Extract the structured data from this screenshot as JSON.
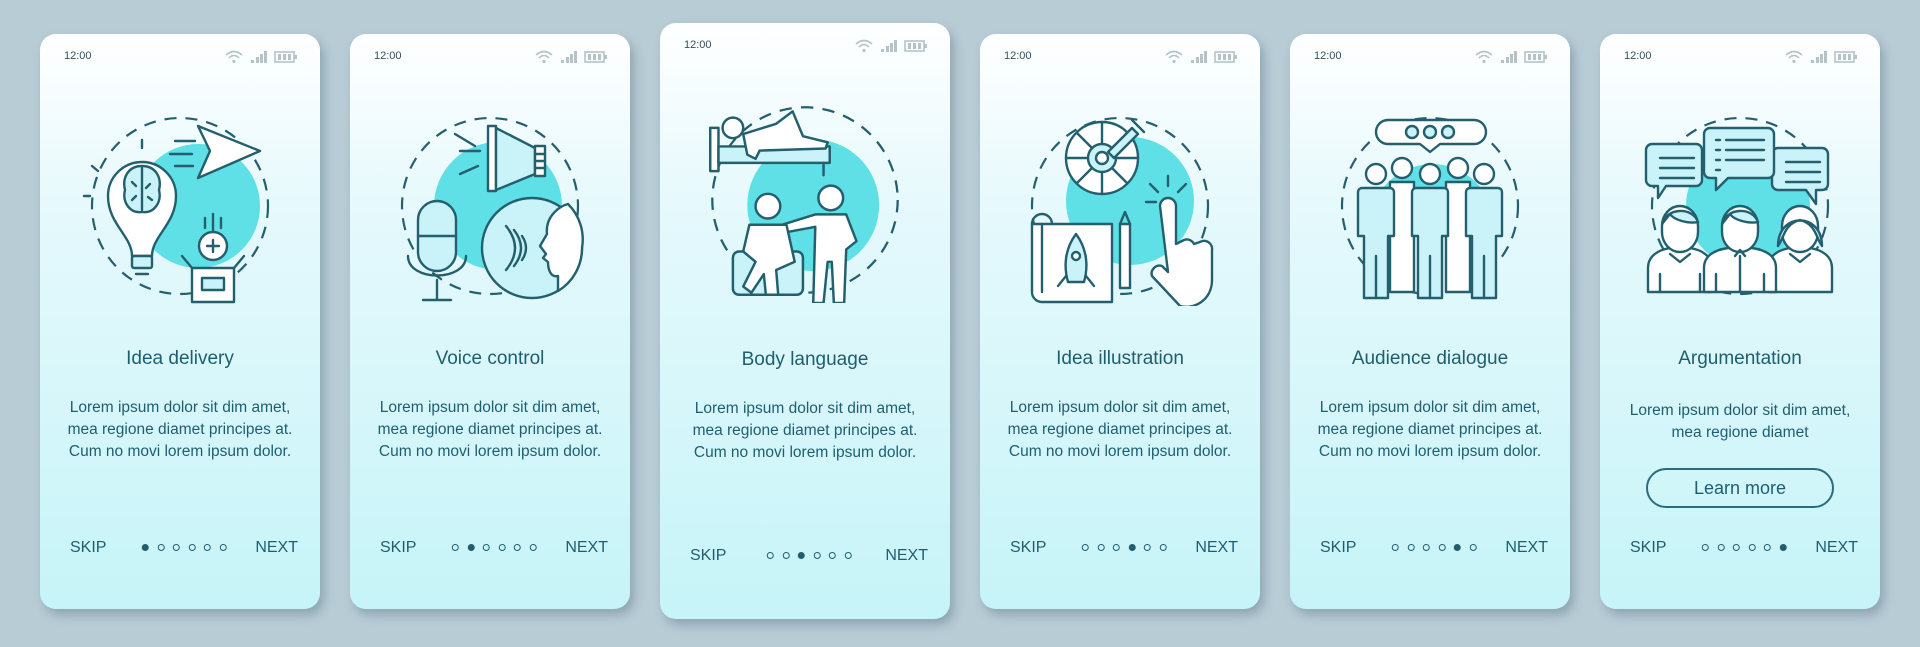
{
  "status_bar": {
    "time": "12:00",
    "icons": [
      "wifi-icon",
      "signal-icon",
      "battery-icon"
    ]
  },
  "navigation": {
    "skip_label": "SKIP",
    "next_label": "NEXT",
    "total_steps": 6
  },
  "colors": {
    "background": "#b8ccd6",
    "accent": "#5fdfe6",
    "text": "#1f5e70"
  },
  "screens": [
    {
      "title": "Idea delivery",
      "illustration": "idea-delivery-icon",
      "active_step": 1,
      "description": "Lorem ipsum dolor sit dim amet, mea regione diamet principes at. Cum no movi lorem ipsum dolor."
    },
    {
      "title": "Voice control",
      "illustration": "voice-control-icon",
      "active_step": 2,
      "description": "Lorem ipsum dolor sit dim amet, mea regione diamet principes at. Cum no movi lorem ipsum dolor."
    },
    {
      "title": "Body language",
      "illustration": "body-language-icon",
      "active_step": 3,
      "description": "Lorem ipsum dolor sit dim amet, mea regione diamet principes at. Cum no movi lorem ipsum dolor."
    },
    {
      "title": "Idea illustration",
      "illustration": "idea-illustration-icon",
      "active_step": 4,
      "description": "Lorem ipsum dolor sit dim amet, mea regione diamet principes at. Cum no movi lorem ipsum dolor."
    },
    {
      "title": "Audience dialogue",
      "illustration": "audience-dialogue-icon",
      "active_step": 5,
      "description": "Lorem ipsum dolor sit dim amet, mea regione diamet principes at. Cum no movi lorem ipsum dolor."
    },
    {
      "title": "Argumentation",
      "illustration": "argumentation-icon",
      "active_step": 6,
      "description": "Lorem ipsum dolor sit dim amet, mea regione diamet",
      "button_label": "Learn more"
    }
  ]
}
